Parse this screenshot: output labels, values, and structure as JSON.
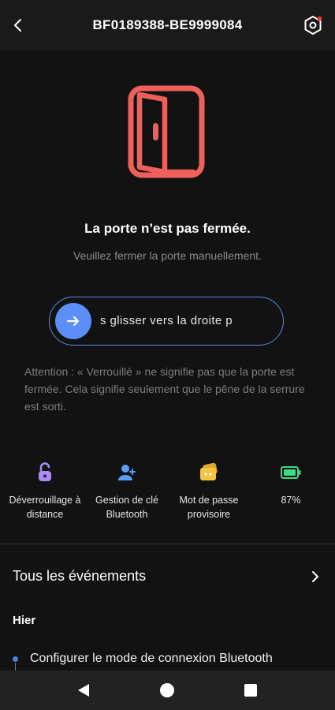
{
  "header": {
    "title": "BF0189388-BE9999084",
    "back_icon": "back-icon",
    "settings_icon": "settings-icon"
  },
  "status": {
    "title": "La porte n’est pas fermée.",
    "subtitle": "Veuillez fermer la porte manuellement.",
    "door_icon_color": "#f0605b"
  },
  "slider": {
    "text": "s glisser vers la droite p",
    "accent": "#5b8ff7"
  },
  "attention": "Attention : « Verrouillé » ne signifie pas que la porte est fermée. Cela signifie seulement que le pêne de la serrure est sorti.",
  "features": [
    {
      "label_line1": "Déverrouillage à",
      "label_line2": "distance",
      "icon": "unlock-icon",
      "color": "#a98bf3"
    },
    {
      "label_line1": "Gestion de clé",
      "label_line2": "Bluetooth",
      "icon": "user-add-icon",
      "color": "#5b9df7"
    },
    {
      "label_line1": "Mot de passe",
      "label_line2": "provisoire",
      "icon": "password-card-icon",
      "color": "#f5c542"
    },
    {
      "label_line1": "87%",
      "icon": "battery-icon",
      "color": "#3ddc84"
    }
  ],
  "events": {
    "title": "Tous les événements",
    "day": "Hier",
    "items": [
      {
        "text": "Configurer le mode de connexion Bluetooth"
      }
    ]
  }
}
